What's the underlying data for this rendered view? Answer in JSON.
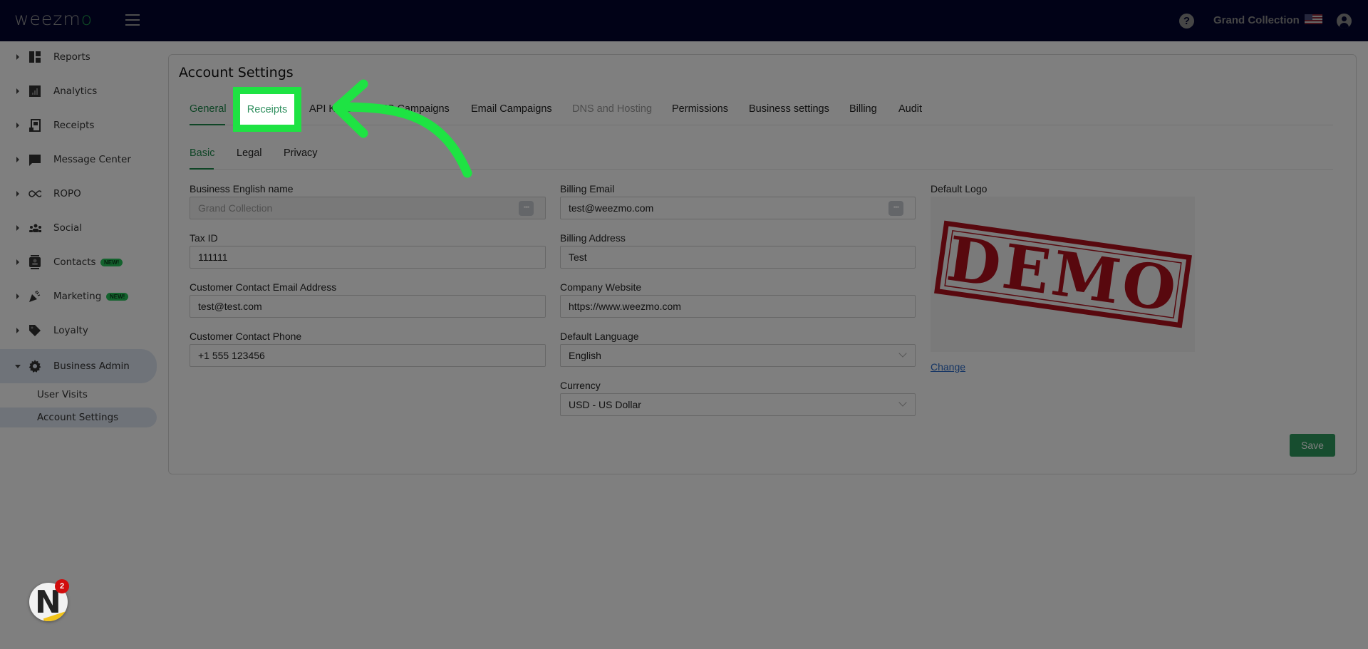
{
  "header": {
    "logo_text": "weezm",
    "logo_accent": "o",
    "store_name": "Grand Collection",
    "icons": [
      "hamburger-menu-icon",
      "help-icon",
      "us-flag-icon",
      "user-account-icon"
    ]
  },
  "sidebar": {
    "items": [
      {
        "label": "Reports",
        "icon": "dashboard-icon"
      },
      {
        "label": "Analytics",
        "icon": "bar-chart-icon"
      },
      {
        "label": "Receipts",
        "icon": "receipt-icon"
      },
      {
        "label": "Message Center",
        "icon": "chat-bubble-icon"
      },
      {
        "label": "ROPO",
        "icon": "infinity-icon"
      },
      {
        "label": "Social",
        "icon": "people-icon"
      },
      {
        "label": "Contacts",
        "icon": "contact-card-icon",
        "badge": "NEW!"
      },
      {
        "label": "Marketing",
        "icon": "party-popper-icon",
        "badge": "NEW!"
      },
      {
        "label": "Loyalty",
        "icon": "tag-heart-icon"
      },
      {
        "label": "Business Admin",
        "icon": "gear-icon",
        "expanded": true
      }
    ],
    "sub_items": [
      {
        "label": "User Visits"
      },
      {
        "label": "Account Settings",
        "active": true
      }
    ]
  },
  "page": {
    "title": "Account Settings",
    "tabs": [
      {
        "label": "General",
        "active": true
      },
      {
        "label": "Receipts"
      },
      {
        "label": "API Keys"
      },
      {
        "label": "SMS Campaigns"
      },
      {
        "label": "Email Campaigns"
      },
      {
        "label": "DNS and Hosting",
        "disabled": true
      },
      {
        "label": "Permissions"
      },
      {
        "label": "Business settings"
      },
      {
        "label": "Billing"
      },
      {
        "label": "Audit"
      }
    ],
    "subtabs": [
      {
        "label": "Basic",
        "active": true
      },
      {
        "label": "Legal"
      },
      {
        "label": "Privacy"
      }
    ]
  },
  "form": {
    "business_english_name": {
      "label": "Business English name",
      "value": "Grand Collection",
      "disabled": true
    },
    "tax_id": {
      "label": "Tax ID",
      "value": "111111"
    },
    "customer_contact_email": {
      "label": "Customer Contact Email Address",
      "value": "test@test.com"
    },
    "customer_contact_phone": {
      "label": "Customer Contact Phone",
      "value": "+1 555 123456"
    },
    "billing_email": {
      "label": "Billing Email",
      "value": "test@weezmo.com"
    },
    "billing_address": {
      "label": "Billing Address",
      "value": "Test"
    },
    "company_website": {
      "label": "Company Website",
      "value": "https://www.weezmo.com"
    },
    "default_language": {
      "label": "Default Language",
      "value": "English"
    },
    "currency": {
      "label": "Currency",
      "value": "USD - US Dollar"
    },
    "default_logo": {
      "label": "Default Logo",
      "image_text": "DEMO",
      "change_label": "Change"
    },
    "save_label": "Save",
    "field_button_glyph": "•••"
  },
  "overlay": {
    "highlight_label": "Receipts",
    "highlight_color": "#1ee343"
  },
  "chat_widget": {
    "letter": "N",
    "notification_count": "2"
  },
  "colors": {
    "header_bg": "#02052e",
    "accent_green": "#1f8a4c",
    "save_green": "#2e9b5e",
    "badge_green": "#26c45a",
    "stamp_red": "#b0101c"
  }
}
